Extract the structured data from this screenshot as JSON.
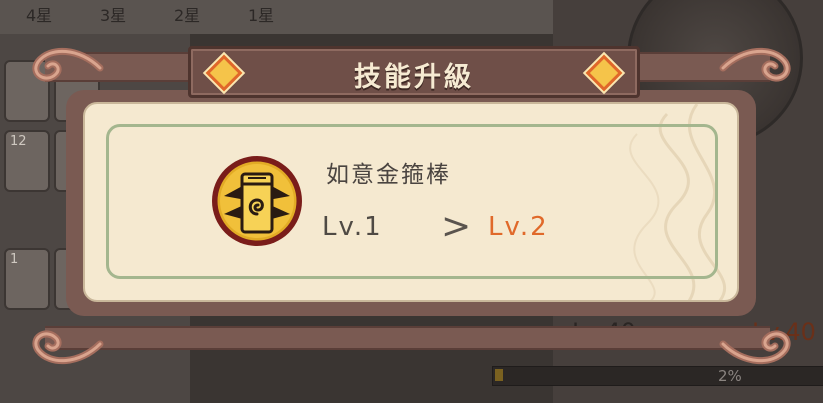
{
  "title": "技能升級",
  "skill": {
    "name": "如意金箍棒",
    "icon": "golden-cudgel-icon",
    "current_level": "Lv.1",
    "arrow": ">",
    "next_level": "Lv.2"
  },
  "background": {
    "tabs": [
      "4星",
      "3星",
      "2星",
      "1星"
    ],
    "card_numbers": [
      "12",
      "1"
    ],
    "level_current": "Lv.40",
    "level_arrow": ">",
    "level_next": "Lv.40",
    "progress_text": "2%",
    "progress_value": 0.02
  },
  "colors": {
    "banner": "#6f4f48",
    "dialog_bg": "#f5e9d0",
    "frame_green": "#a4b68e",
    "next_level_orange": "#e0692a",
    "diamond_gold": "#f5c44a"
  }
}
